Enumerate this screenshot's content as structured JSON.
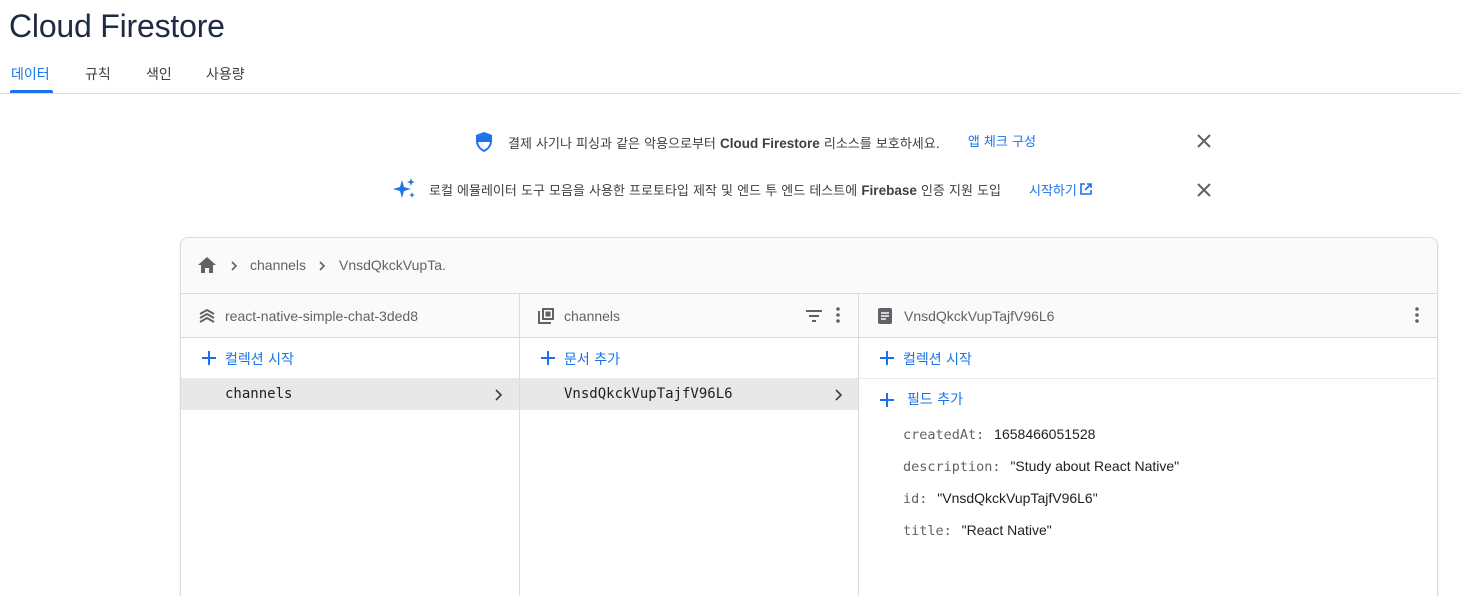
{
  "page": {
    "title": "Cloud Firestore"
  },
  "tabs": [
    {
      "label": "데이터",
      "active": true
    },
    {
      "label": "규칙",
      "active": false
    },
    {
      "label": "색인",
      "active": false
    },
    {
      "label": "사용량",
      "active": false
    }
  ],
  "banners": [
    {
      "icon": "shield-icon",
      "text_before": "결제 사기나 피싱과 같은 악용으로부터 ",
      "text_bold": "Cloud Firestore",
      "text_after": " 리소스를 보호하세요.",
      "link": "앱 체크 구성"
    },
    {
      "icon": "sparkle-icon",
      "text_before": "로컬 에뮬레이터 도구 모음을 사용한 프로토타입 제작 및 엔드 투 엔드 테스트에 ",
      "text_bold": "Firebase",
      "text_after": " 인증 지원 도입",
      "link": "시작하기"
    }
  ],
  "breadcrumb": {
    "items": [
      "channels",
      "VnsdQkckVupTa."
    ]
  },
  "columns": {
    "root": {
      "title": "react-native-simple-chat-3ded8",
      "add_label": "컬렉션 시작",
      "items": [
        "channels"
      ]
    },
    "collection": {
      "title": "channels",
      "add_label": "문서 추가",
      "items": [
        "VnsdQkckVupTajfV96L6"
      ]
    },
    "document": {
      "title": "VnsdQkckVupTajfV96L6",
      "add_collection_label": "컬렉션 시작",
      "add_field_label": "필드 추가",
      "fields": [
        {
          "key": "createdAt:",
          "value": "1658466051528"
        },
        {
          "key": "description:",
          "value": "\"Study about React Native\""
        },
        {
          "key": "id:",
          "value": "\"VnsdQkckVupTajfV96L6\""
        },
        {
          "key": "title:",
          "value": "\"React Native\""
        }
      ]
    }
  },
  "colors": {
    "accent": "#1a73e8",
    "title": "#1f2a44",
    "selected_row": "#e8e8e8"
  }
}
